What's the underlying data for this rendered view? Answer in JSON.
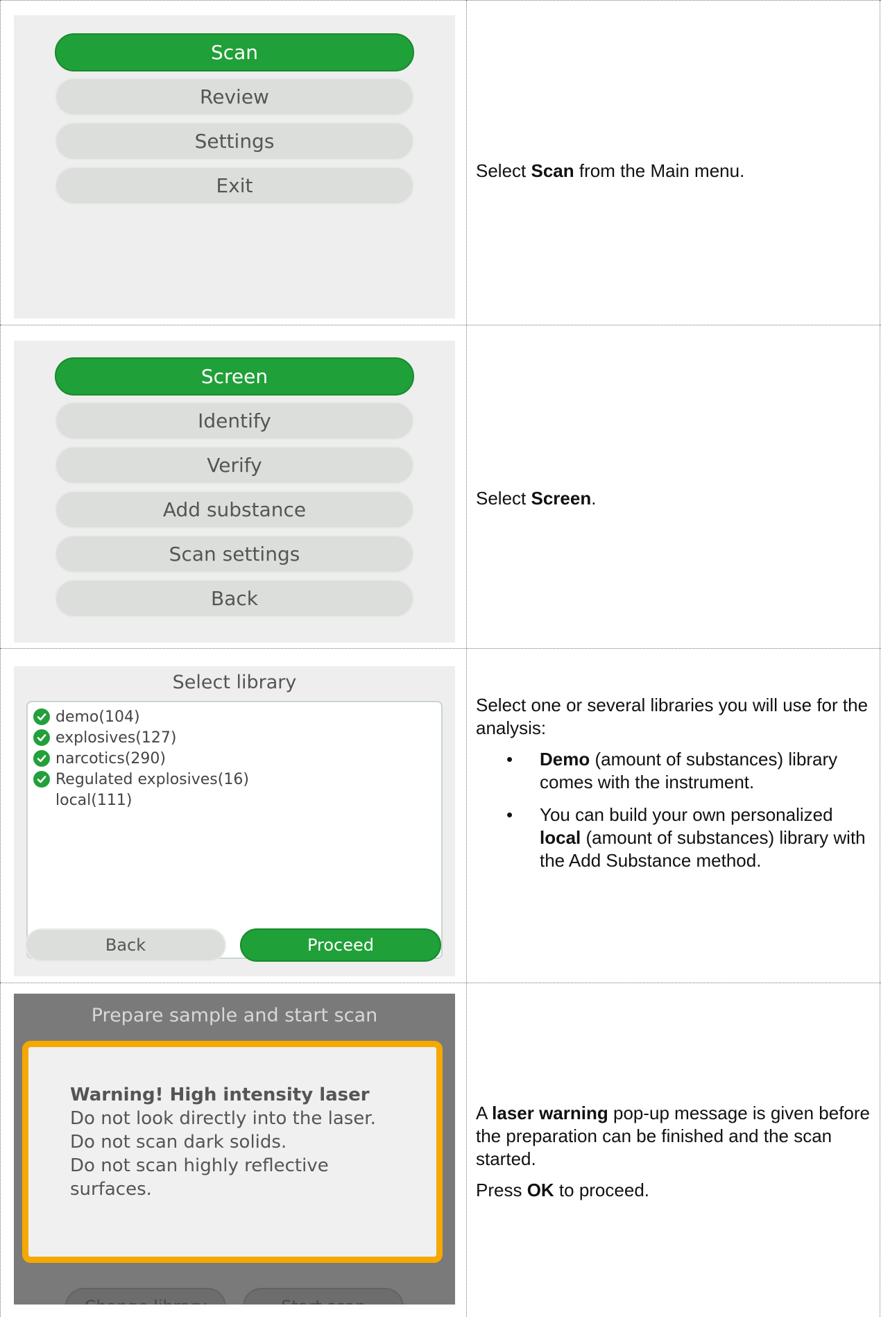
{
  "row1": {
    "menu": [
      "Scan",
      "Review",
      "Settings",
      "Exit"
    ],
    "text_prefix": "Select ",
    "text_bold": "Scan",
    "text_suffix": " from the Main menu."
  },
  "row2": {
    "menu": [
      "Screen",
      "Identify",
      "Verify",
      "Add substance",
      "Scan settings",
      "Back"
    ],
    "text_prefix": "Select ",
    "text_bold": "Screen",
    "text_suffix": "."
  },
  "row3": {
    "title": "Select library",
    "libraries": [
      {
        "label": "demo(104)",
        "checked": true
      },
      {
        "label": "explosives(127)",
        "checked": true
      },
      {
        "label": "narcotics(290)",
        "checked": true
      },
      {
        "label": "Regulated explosives(16)",
        "checked": true
      },
      {
        "label": "local(111)",
        "checked": false
      }
    ],
    "back_label": "Back",
    "proceed_label": "Proceed",
    "intro": "Select one or several libraries you will use for the analysis:",
    "bullet1_bold": "Demo",
    "bullet1_rest": " (amount of substances) library comes with the instrument.",
    "bullet2_pre": "You can build your own personalized ",
    "bullet2_bold": "local",
    "bullet2_rest": " (amount of substances) library with the Add Substance method."
  },
  "row4": {
    "title": "Prepare sample and start scan",
    "warning_heading": "Warning! High intensity laser",
    "warning_lines": [
      "Do not look directly into the laser.",
      "Do not scan dark solids.",
      "Do not scan highly reflective",
      "surfaces."
    ],
    "change_library_label": "Change library",
    "start_scan_label": "Start scan",
    "p1_pre": "A ",
    "p1_bold": "laser warning",
    "p1_rest": " pop-up message is given before the preparation can be finished and the scan started.",
    "p2_pre": "Press ",
    "p2_bold": "OK",
    "p2_rest": " to proceed."
  },
  "colors": {
    "green": "#20a038",
    "gray_button": "#dcdedc",
    "warning_border": "#f5a800",
    "dark_overlay": "#7a7a7a"
  }
}
